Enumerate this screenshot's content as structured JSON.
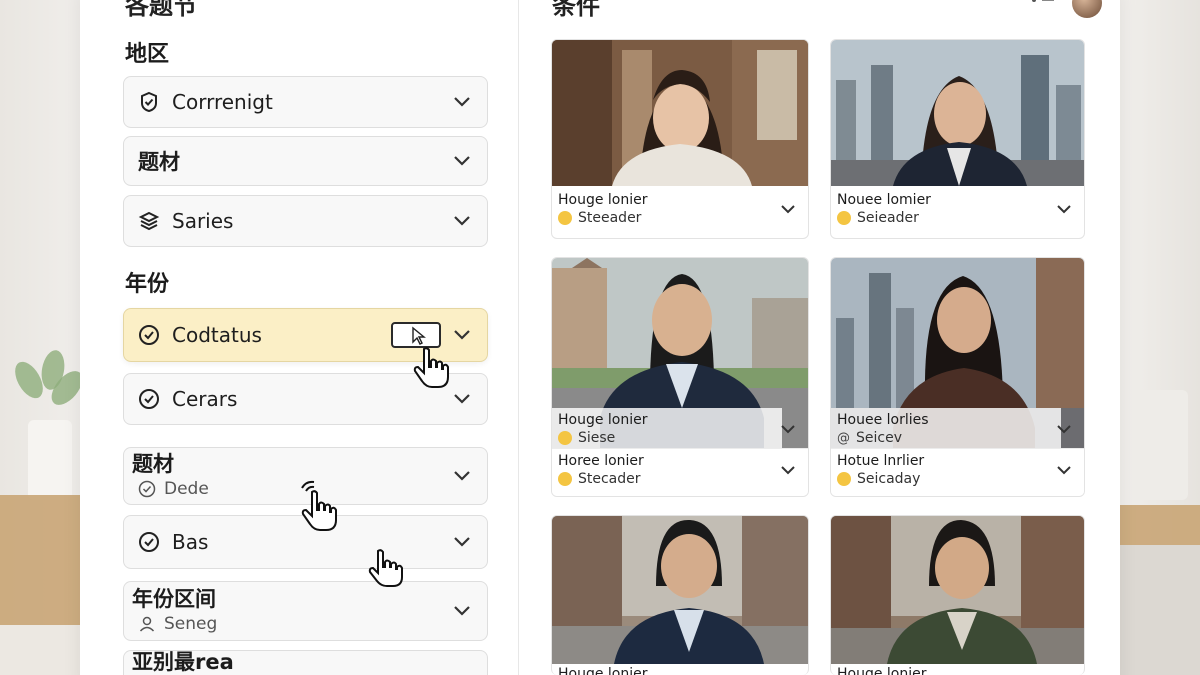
{
  "sidebar": {
    "heading": "各题节",
    "region_title": "地区",
    "year_title": "年份",
    "filters": [
      {
        "label": "Corrrenigt",
        "icon": "check-circle-icon"
      },
      {
        "label": "题材",
        "icon": ""
      },
      {
        "label": "Saries",
        "icon": "layers-icon"
      }
    ],
    "year_filters": [
      {
        "label": "Codtatus",
        "icon": "check-circle-icon",
        "active": true
      },
      {
        "label": "Cerars",
        "icon": "check-circle-icon"
      }
    ],
    "genre_filter": {
      "title": "题材",
      "sub": "Dede",
      "icon": "check-circle-icon"
    },
    "bas_filter": {
      "label": "Bas",
      "icon": "check-circle-icon"
    },
    "range_filter": {
      "title": "年份区间",
      "sub": "Seneg",
      "icon": "user-icon"
    },
    "cut_filter": {
      "title": "亚别最rea"
    }
  },
  "results": {
    "heading": "条件",
    "cards": [
      {
        "name": "Houge lonier",
        "role": "Steeader"
      },
      {
        "name": "Nouee lomier",
        "role": "Seieader"
      },
      {
        "name": "Houge lonier",
        "role": "Siese",
        "extra_name": "Horee lonier",
        "extra_role": "Stecader"
      },
      {
        "name": "Houee lorlies",
        "role": "Seicev",
        "extra_name": "Hotue lnrlier",
        "extra_role": "Seicaday"
      },
      {
        "name": "Houge lonier",
        "role": ""
      },
      {
        "name": "Houge lonier",
        "role": ""
      }
    ]
  },
  "colors": {
    "active_filter_bg": "#fbefc6",
    "accent_smile": "#f4c542"
  }
}
